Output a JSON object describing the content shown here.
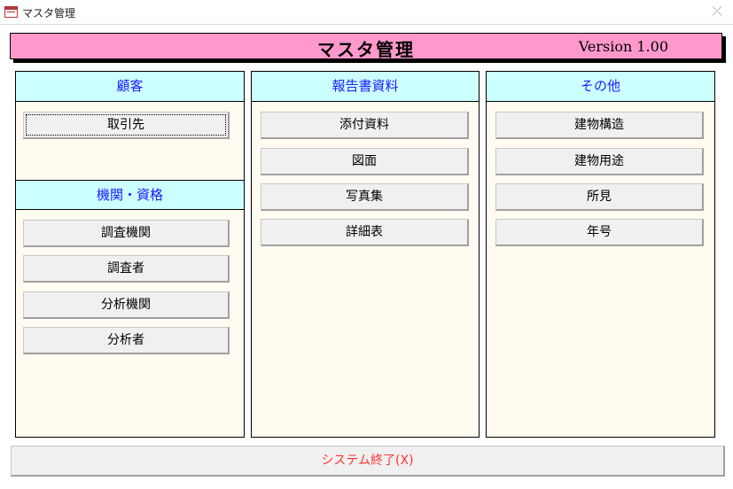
{
  "window": {
    "title": "マスタ管理",
    "close_glyph": "⤫"
  },
  "header": {
    "title": "マスタ管理",
    "version": "Version 1.00"
  },
  "panels": {
    "customer": {
      "header": "顧客",
      "buttons": [
        "取引先"
      ]
    },
    "institution": {
      "header": "機関・資格",
      "buttons": [
        "調査機関",
        "調査者",
        "分析機関",
        "分析者"
      ]
    },
    "report": {
      "header": "報告書資料",
      "buttons": [
        "添付資料",
        "図面",
        "写真集",
        "詳細表"
      ]
    },
    "other": {
      "header": "その他",
      "buttons": [
        "建物構造",
        "建物用途",
        "所見",
        "年号"
      ]
    }
  },
  "exit_button": {
    "label": "システム終了(X)"
  },
  "colors": {
    "header_bg": "#ff99cc",
    "section_bg": "#ccffff",
    "section_text": "#1a1aff",
    "panel_bg": "#fffbf0",
    "exit_text": "#ff3333"
  }
}
